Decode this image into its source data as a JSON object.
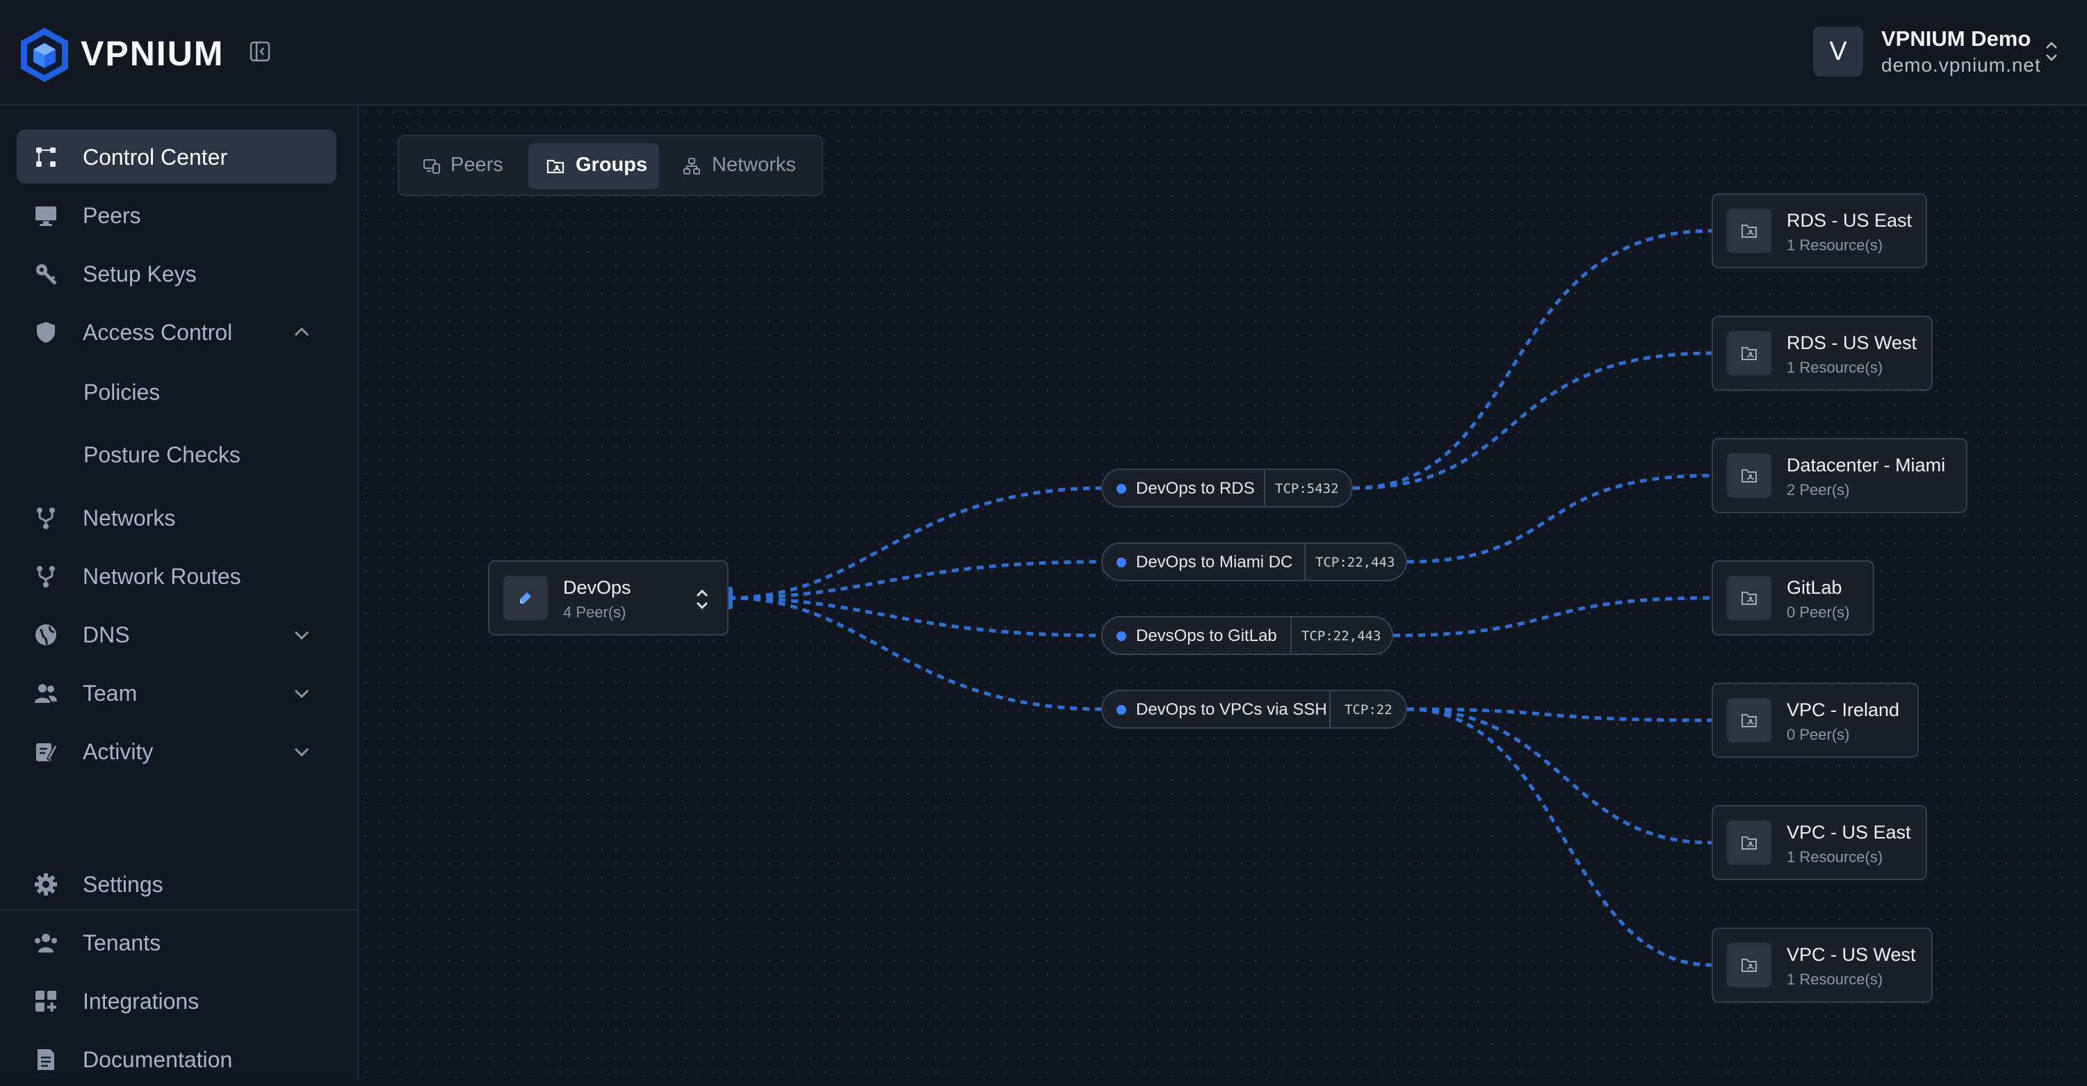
{
  "app": {
    "brand": "VPNIUM",
    "accent": "#3b82f6"
  },
  "account": {
    "initial": "V",
    "name": "VPNIUM Demo",
    "domain": "demo.vpnium.net"
  },
  "sidebar": {
    "items": [
      {
        "label": "Control Center",
        "icon": "grid-icon"
      },
      {
        "label": "Peers",
        "icon": "monitor-icon"
      },
      {
        "label": "Setup Keys",
        "icon": "key-icon"
      },
      {
        "label": "Access Control",
        "icon": "shield-icon"
      },
      {
        "label": "Networks",
        "icon": "network-icon"
      },
      {
        "label": "Network Routes",
        "icon": "route-icon"
      },
      {
        "label": "DNS",
        "icon": "globe-icon"
      },
      {
        "label": "Team",
        "icon": "users-icon"
      },
      {
        "label": "Activity",
        "icon": "activity-icon"
      }
    ],
    "sub_items": [
      {
        "label": "Policies"
      },
      {
        "label": "Posture Checks"
      }
    ],
    "footer": [
      {
        "label": "Settings",
        "icon": "gear-icon"
      },
      {
        "label": "Tenants",
        "icon": "tenants-icon"
      },
      {
        "label": "Integrations",
        "icon": "integrations-icon"
      },
      {
        "label": "Documentation",
        "icon": "document-icon"
      }
    ]
  },
  "tabs": [
    {
      "label": "Peers"
    },
    {
      "label": "Groups"
    },
    {
      "label": "Networks"
    }
  ],
  "graph": {
    "source": {
      "title": "DevOps",
      "subtitle": "4 Peer(s)"
    },
    "policies": [
      {
        "name": "DevOps to RDS",
        "port": "TCP:5432"
      },
      {
        "name": "DevOps to Miami DC",
        "port": "TCP:22,443"
      },
      {
        "name": "DevsOps to GitLab",
        "port": "TCP:22,443"
      },
      {
        "name": "DevOps to VPCs via SSH",
        "port": "TCP:22"
      }
    ],
    "targets": [
      {
        "title": "RDS - US East",
        "subtitle": "1 Resource(s)"
      },
      {
        "title": "RDS - US West",
        "subtitle": "1 Resource(s)"
      },
      {
        "title": "Datacenter - Miami",
        "subtitle": "2 Peer(s)"
      },
      {
        "title": "GitLab",
        "subtitle": "0 Peer(s)"
      },
      {
        "title": "VPC - Ireland",
        "subtitle": "0 Peer(s)"
      },
      {
        "title": "VPC - US East",
        "subtitle": "1 Resource(s)"
      },
      {
        "title": "VPC - US West",
        "subtitle": "1 Resource(s)"
      }
    ]
  }
}
